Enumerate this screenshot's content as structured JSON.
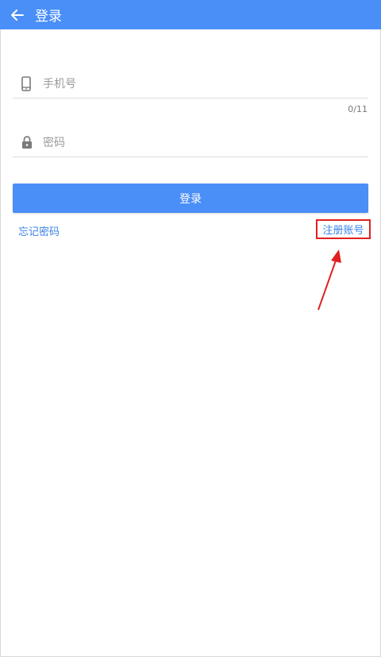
{
  "appbar": {
    "title": "登录",
    "back_icon": "arrow-left-icon",
    "background": "#4a8ef7"
  },
  "form": {
    "phone_placeholder": "手机号",
    "phone_icon": "phone-icon",
    "phone_counter": "0/11",
    "password_placeholder": "密码",
    "password_icon": "lock-icon"
  },
  "actions": {
    "login_label": "登录",
    "forgot_label": "忘记密码",
    "register_label": "注册账号"
  },
  "annotation": {
    "highlight_color": "#e02020"
  }
}
